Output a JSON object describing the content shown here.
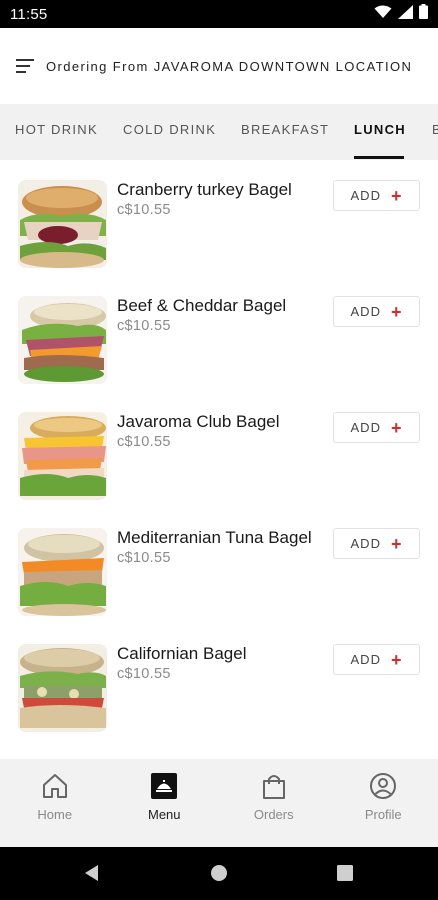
{
  "status_bar": {
    "time": "11:55",
    "icons": [
      "wifi-icon",
      "signal-icon",
      "battery-icon"
    ]
  },
  "header": {
    "menu_icon": "sort-lines-icon",
    "ordering_text": "Ordering From JAVAROMA DOWNTOWN LOCATION"
  },
  "tabs": [
    {
      "label": "HOT DRINK",
      "active": false
    },
    {
      "label": "COLD DRINK",
      "active": false
    },
    {
      "label": "BREAKFAST",
      "active": false
    },
    {
      "label": "LUNCH",
      "active": true
    },
    {
      "label": "B",
      "active": false
    }
  ],
  "products": [
    {
      "name": "Cranberry turkey Bagel",
      "price": "c$10.55",
      "add_label": "ADD",
      "add_icon": "plus-icon"
    },
    {
      "name": "Beef & Cheddar Bagel",
      "price": "c$10.55",
      "add_label": "ADD",
      "add_icon": "plus-icon"
    },
    {
      "name": "Javaroma Club Bagel",
      "price": "c$10.55",
      "add_label": "ADD",
      "add_icon": "plus-icon"
    },
    {
      "name": "Mediterranian Tuna Bagel",
      "price": "c$10.55",
      "add_label": "ADD",
      "add_icon": "plus-icon"
    },
    {
      "name": "Californian Bagel",
      "price": "c$10.55",
      "add_label": "ADD",
      "add_icon": "plus-icon"
    }
  ],
  "bottom_nav": [
    {
      "label": "Home",
      "icon": "home-icon",
      "active": false
    },
    {
      "label": "Menu",
      "icon": "menu-icon",
      "active": true
    },
    {
      "label": "Orders",
      "icon": "shopping-bag-icon",
      "active": false
    },
    {
      "label": "Profile",
      "icon": "profile-icon",
      "active": false
    }
  ],
  "colors": {
    "accent_plus": "#d42b2b",
    "tabs_background": "#f1f1f2",
    "bottom_nav_background": "#f2f2f2"
  }
}
